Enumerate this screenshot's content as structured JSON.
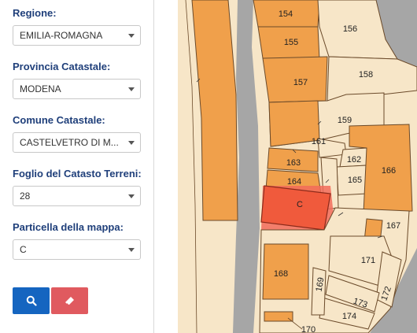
{
  "form": {
    "regione": {
      "label": "Regione:",
      "value": "EMILIA-ROMAGNA"
    },
    "provincia": {
      "label": "Provincia Catastale:",
      "value": "MODENA"
    },
    "comune": {
      "label": "Comune Catastale:",
      "value": "CASTELVETRO DI M..."
    },
    "foglio": {
      "label": "Foglio del Catasto Terreni:",
      "value": "28"
    },
    "particella": {
      "label": "Particella della mappa:",
      "value": "C"
    }
  },
  "buttons": {
    "search_icon": "search-icon",
    "clear_icon": "eraser-icon",
    "search_color": "#1565c0",
    "clear_color": "#e05a5f"
  },
  "map": {
    "parcels": {
      "p154": "154",
      "p155": "155",
      "p156": "156",
      "p157": "157",
      "p158": "158",
      "p159": "159",
      "p161": "161",
      "p162": "162",
      "p163": "163",
      "p164": "164",
      "p165": "165",
      "p166": "166",
      "pC": "C",
      "p167": "167",
      "p168": "168",
      "p169": "169",
      "p171": "171",
      "p172": "172",
      "p173": "173",
      "p174": "174",
      "p170": "170"
    },
    "colors": {
      "building": "#f0a04b",
      "land": "#f7e6c8",
      "road": "#a6a6a6",
      "selected": "#f05a3c"
    }
  }
}
